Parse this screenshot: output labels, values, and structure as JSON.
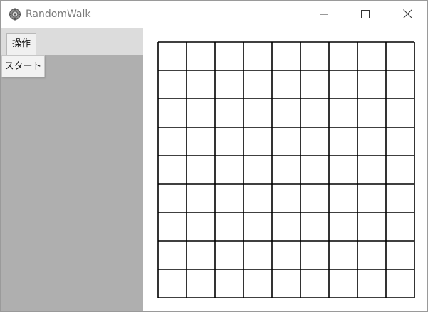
{
  "window": {
    "title": "RandomWalk",
    "icon": "app-gear-icon",
    "controls": [
      "minimize-icon",
      "maximize-icon",
      "close-icon"
    ]
  },
  "sidebar": {
    "tabs": [
      {
        "label": "操作"
      }
    ],
    "menu_items": [
      {
        "label": "スタート"
      }
    ]
  },
  "board": {
    "rows": 9,
    "columns": 9,
    "line_color": "#000000",
    "background": "#ffffff"
  },
  "colors": {
    "sidebar_background": "#afafaf",
    "tab_strip_background": "#dcdcdc"
  }
}
